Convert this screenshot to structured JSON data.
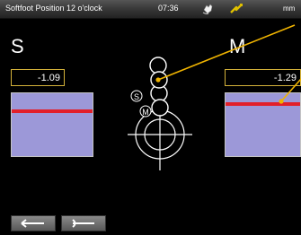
{
  "header": {
    "title": "Softfoot Position 12 o'clock",
    "time": "07:36",
    "unit": "mm",
    "icons": [
      "hand-rotate-icon",
      "laser-signal-icon"
    ]
  },
  "left_panel": {
    "label": "S",
    "value": "-1.09",
    "red_line_level": 0.28
  },
  "right_panel": {
    "label": "M",
    "value": "-1.29",
    "red_line_level": 0.42
  },
  "target": {
    "marker_s": "S",
    "marker_m": "M"
  },
  "nav": {
    "icons": [
      "arrow-left-icon",
      "arrow-right-icon"
    ]
  },
  "colors": {
    "gauge_fill": "#9c98d8",
    "red_line": "#e21f2a",
    "indicator": "#f0b400",
    "box_border": "#d4b23a"
  }
}
